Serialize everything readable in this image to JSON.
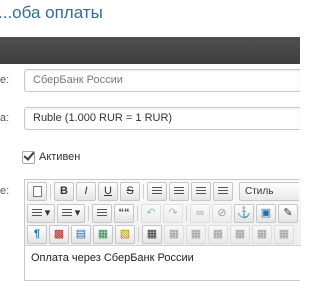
{
  "header": {
    "title": "...оба оплаты"
  },
  "form": {
    "name_label": "е:",
    "name_value": "СберБанк России",
    "currency_label": "а:",
    "currency_value": "Ruble (1.000 RUR = 1 RUR)",
    "active_label": "Активен",
    "active_checked": true,
    "description_label": "е:",
    "style_select_label": "Стиль",
    "editor_content": "Оплата через СберБанк России"
  },
  "toolbar": {
    "bold": "B",
    "italic": "I",
    "underline": "U",
    "strike": "S",
    "quote": "““",
    "paragraph": "¶"
  },
  "colors": {
    "title": "#2f6f95",
    "darkbar": "#444444"
  }
}
